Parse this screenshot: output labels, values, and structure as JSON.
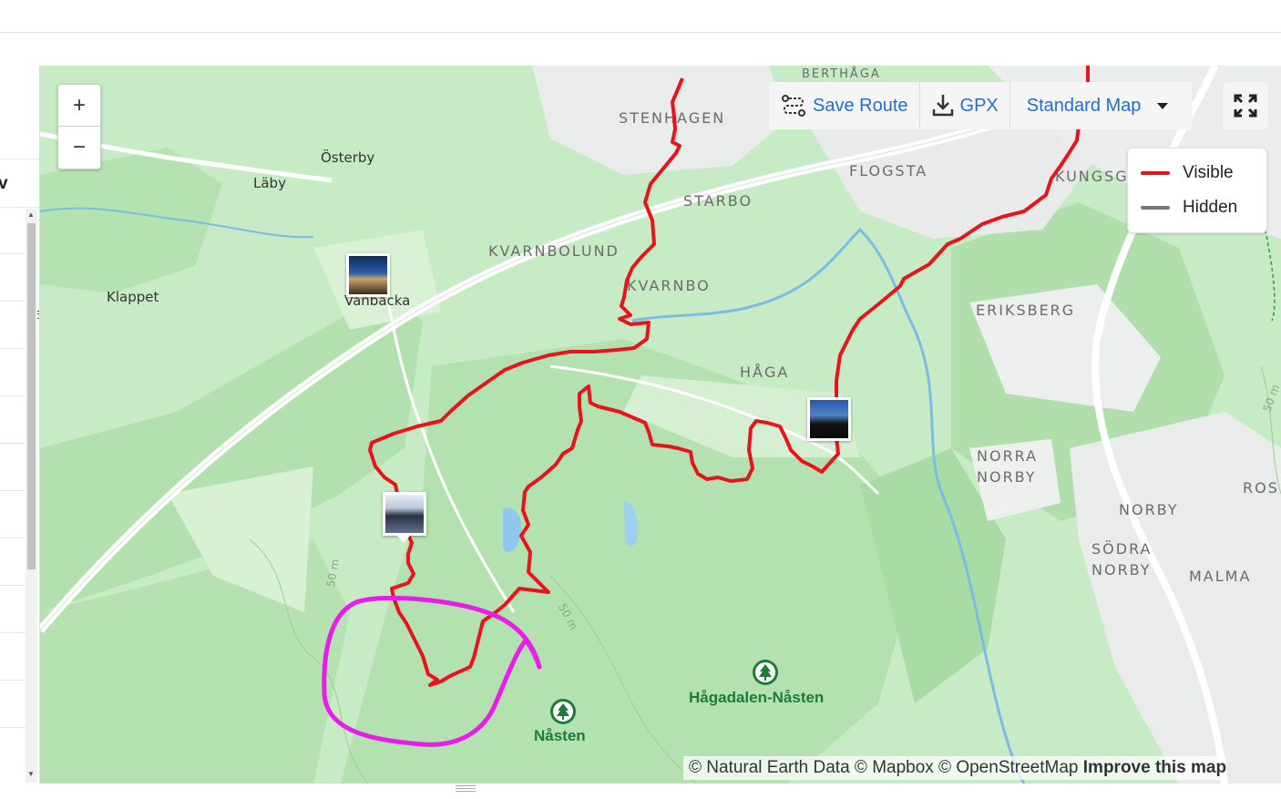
{
  "left_panel": {
    "header_fragment": "v",
    "side_fragment": "5"
  },
  "map": {
    "zoom_in": "+",
    "zoom_out": "−",
    "toolbar": {
      "save_route": "Save Route",
      "gpx": "GPX",
      "map_style": "Standard Map"
    },
    "legend": [
      {
        "label": "Visible",
        "color": "#e8141c"
      },
      {
        "label": "Hidden",
        "color": "#777777"
      }
    ],
    "places": {
      "stenhagen": "STENHAGEN",
      "berthaga": "BERTHÅGA",
      "flogsta": "FLOGSTA",
      "kungsgardet": "KUNGSG",
      "starbo": "STARBO",
      "osterby": "Österby",
      "laby": "Läby",
      "kvarnbolund": "KVARNBOLUND",
      "kvarnbo": "KVARNBO",
      "klappet": "Klappet",
      "vanbacka": "Vanbacka",
      "eriksberg": "ERIKSBERG",
      "haga": "HÅGA",
      "norra_norby_1": "NORRA",
      "norra_norby_2": "NORBY",
      "norby": "NORBY",
      "sodra_norby_1": "SÖDRA",
      "sodra_norby_2": "NORBY",
      "malma": "MALMA",
      "ros": "ROS",
      "hagadalen": "Hågadalen-Nåsten",
      "nasten": "Nåsten",
      "contour_1": "50 m",
      "contour_2": "50 m",
      "contour_3": "50 m"
    },
    "attribution": {
      "text": "© Natural Earth Data © Mapbox © OpenStreetMap",
      "improve": "Improve this map"
    },
    "colors": {
      "route": "#e8141c",
      "annotation": "#e81ee8",
      "park": "#c7ebc4",
      "forest": "#a8dca6",
      "urban": "#ececec",
      "water": "#6fb3e8"
    }
  }
}
